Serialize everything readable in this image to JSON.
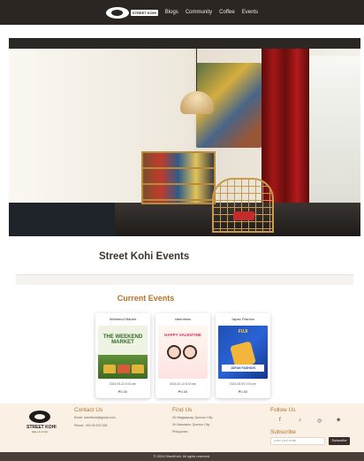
{
  "nav": {
    "logo_text": "STREET KOHI",
    "links": [
      "Blogs",
      "Community",
      "Coffee",
      "Events"
    ]
  },
  "events_title": "Street Kohi Events",
  "current_events_title": "Current Events",
  "events": [
    {
      "name": "Weekend Market",
      "poster_title": "THE WEEKEND MARKET",
      "date": "2024-09-22 8:02 am",
      "price": "₱0.00"
    },
    {
      "name": "Valentines",
      "poster_title": "HAPPY VALENTINE",
      "date": "2024-02-14 8:00 am",
      "price": "₱0.00"
    },
    {
      "name": "Japan Fashion",
      "poster_title": "FUJI",
      "poster_banner": "JAPAN FASHION",
      "date": "2024-08-09 3:00 pm",
      "price": "₱0.00"
    }
  ],
  "footer": {
    "logo_name": "STREET KOHI",
    "logo_sub": "DELI & KOHI",
    "contact": {
      "heading": "Contact Us",
      "email": "Email: streetkohi@gmail.com",
      "phone": "Phone: +63 99 578 396"
    },
    "find": {
      "heading": "Find Us",
      "line1": "2D Magsaysay, Quezon City",
      "line2": "2H Mandarin, Quezon City",
      "line3": "Philippines"
    },
    "follow_heading": "Follow Us",
    "social_icons": [
      "facebook-icon",
      "tiktok-icon",
      "instagram-icon",
      "discord-icon"
    ],
    "subscribe_heading": "Subscribe",
    "email_placeholder": "enter your email",
    "subscribe_label": "Subscribe"
  },
  "copyright": "© 2024 StreetKohi. All rights reserved.",
  "colors": {
    "nav_bg": "#2b2621",
    "accent": "#b5702a",
    "footer_bg": "#fbf0e4",
    "copyright_bg": "#4a3f38"
  }
}
